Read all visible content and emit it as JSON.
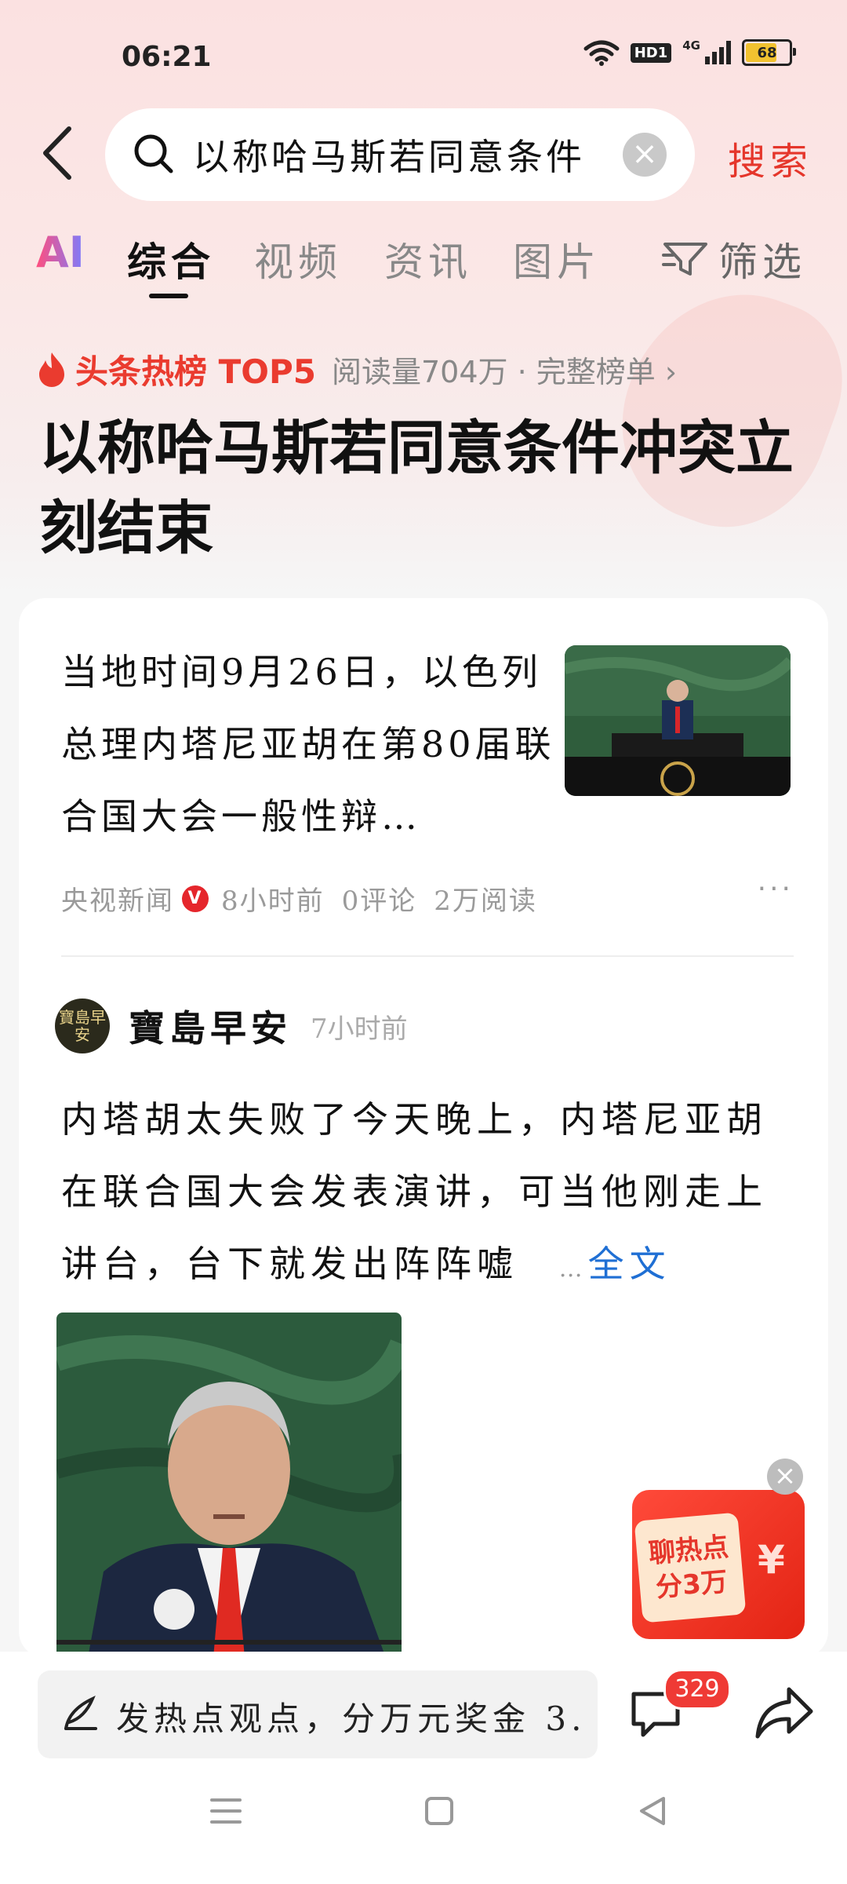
{
  "status_bar": {
    "time": "06:21",
    "hd_label": "HD1",
    "network_label": "4G",
    "battery_level": "68"
  },
  "search": {
    "query": "以称哈马斯若同意条件",
    "search_label": "搜索"
  },
  "tabs": {
    "ai_label": "AI",
    "items": [
      "综合",
      "视频",
      "资讯",
      "图片"
    ],
    "active_index": 0,
    "filter_label": "筛选"
  },
  "hot": {
    "title": "头条热榜 TOP5",
    "meta": "阅读量704万 · 完整榜单 ›",
    "headline": "以称哈马斯若同意条件冲突立刻结束"
  },
  "news_card": {
    "text": "当地时间9月26日，以色列总理内塔尼亚胡在第80届联合国大会一般性辩…",
    "source": "央视新闻",
    "verified_badge": "V",
    "time": "8小时前",
    "comments": "0评论",
    "reads": "2万阅读",
    "more": "···"
  },
  "post": {
    "author": "寶島早安",
    "avatar_text": "寶島早安",
    "time": "7小时前",
    "text": "内塔胡太失败了今天晚上，内塔尼亚胡在联合国大会发表演讲，可当他刚走上讲台，台下就发出阵阵嘘",
    "ellipsis": "…",
    "expand_label": "全文"
  },
  "promo": {
    "text": "聊热点分3万",
    "close": "×",
    "currency": "¥"
  },
  "bottom_bar": {
    "comment_placeholder": "发热点观点，分万元奖金 3.",
    "comment_count": "329"
  },
  "colors": {
    "accent_red": "#e5362b",
    "link_blue": "#1f6fd4",
    "badge_red": "#ef3a35"
  }
}
